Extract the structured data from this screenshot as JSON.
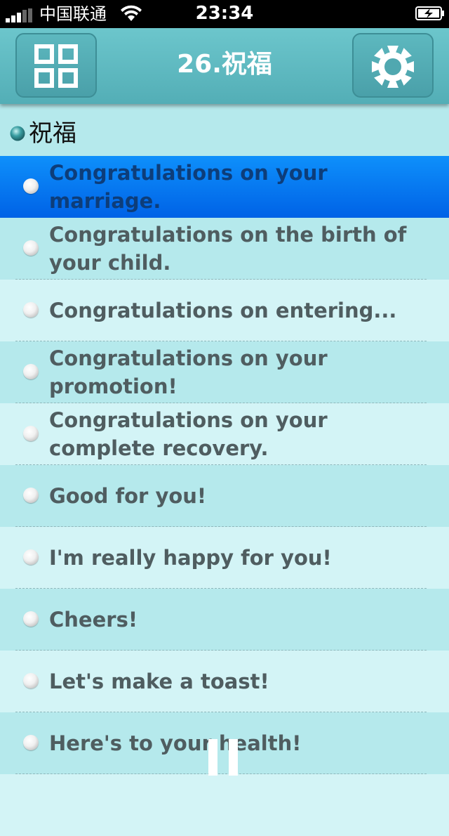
{
  "status_bar": {
    "carrier": "中国联通",
    "time": "23:34"
  },
  "header": {
    "title": "26.祝福",
    "left_button_icon": "grid-menu-icon",
    "right_button_icon": "settings-gear-icon"
  },
  "section": {
    "title": "祝福"
  },
  "phrases": [
    {
      "text": "Congratulations on your marriage.",
      "selected": true
    },
    {
      "text": "Congratulations on the birth of your child.",
      "selected": false
    },
    {
      "text": "Congratulations on entering...",
      "selected": false
    },
    {
      "text": "Congratulations on your promotion!",
      "selected": false
    },
    {
      "text": "Congratulations on your complete recovery.",
      "selected": false
    },
    {
      "text": "Good for you!",
      "selected": false
    },
    {
      "text": "I'm really happy for you!",
      "selected": false
    },
    {
      "text": "Cheers!",
      "selected": false
    },
    {
      "text": "Let's make a toast!",
      "selected": false
    },
    {
      "text": "Here's to your health!",
      "selected": false
    }
  ],
  "playback": {
    "icon": "pause-icon"
  },
  "colors": {
    "header": "#5bb8bf",
    "row_light": "#d3f4f6",
    "row_dark": "#b5e9ec",
    "selected": "#0a78f0",
    "text": "#4f5d60"
  }
}
